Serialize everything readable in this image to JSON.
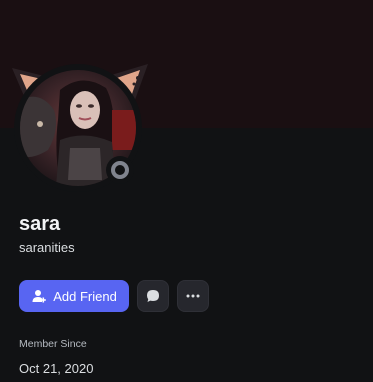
{
  "profile": {
    "display_name": "sara",
    "username": "saranities",
    "status": "offline",
    "banner_color": "#1a0f12"
  },
  "actions": {
    "add_friend_label": "Add Friend",
    "add_friend_icon": "person-add-icon",
    "message_icon": "chat-bubble-icon",
    "more_icon": "ellipsis-icon"
  },
  "member_since": {
    "label": "Member Since",
    "date": "Oct 21, 2020"
  },
  "colors": {
    "accent": "#5865f2",
    "background": "#111214",
    "status_offline": "#80848e"
  }
}
